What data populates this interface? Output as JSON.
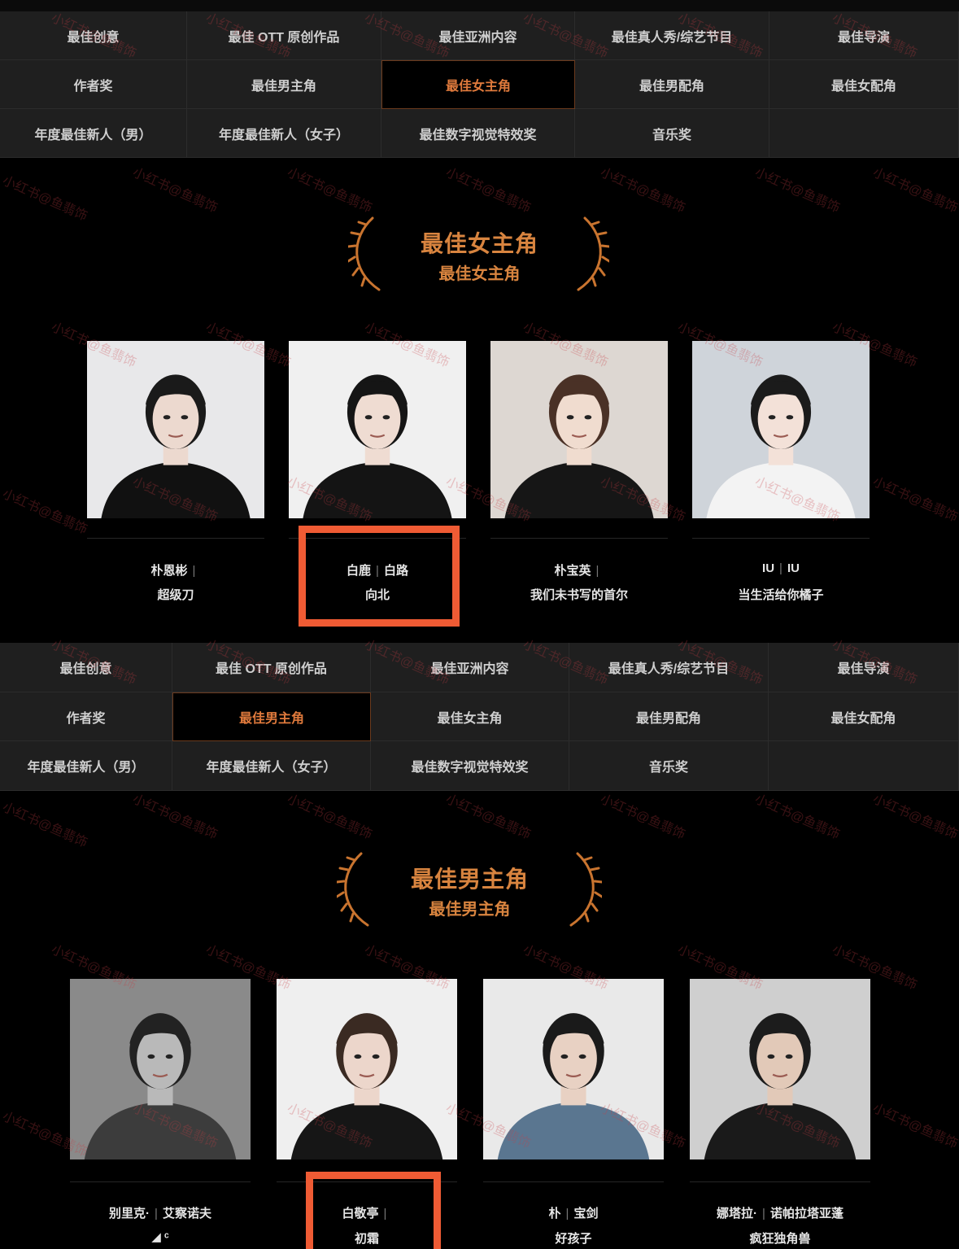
{
  "categories": [
    "最佳创意",
    "最佳 OTT 原创作品",
    "最佳亚洲内容",
    "最佳真人秀/综艺节目",
    "最佳导演",
    "作者奖",
    "最佳男主角",
    "最佳女主角",
    "最佳男配角",
    "最佳女配角",
    "年度最佳新人（男）",
    "年度最佳新人（女子）",
    "最佳数字视觉特效奖",
    "音乐奖",
    ""
  ],
  "section1": {
    "active_category": "最佳女主角",
    "award_title": "最佳女主角",
    "award_subtitle": "最佳女主角",
    "nominees": [
      {
        "name_a": "朴恩彬",
        "sep": "|",
        "name_b": "",
        "work": "超级刀",
        "highlight": false
      },
      {
        "name_a": "白鹿",
        "sep": "|",
        "name_b": "白路",
        "work": "向北",
        "highlight": true
      },
      {
        "name_a": "朴宝英",
        "sep": "|",
        "name_b": "",
        "work": "我们未书写的首尔",
        "highlight": false
      },
      {
        "name_a": "IU",
        "sep": "|",
        "name_b": "IU",
        "work": "当生活给你橘子",
        "highlight": false
      }
    ]
  },
  "section2": {
    "active_category": "最佳男主角",
    "award_title": "最佳男主角",
    "award_subtitle": "最佳男主角",
    "nominees": [
      {
        "name_a": "别里克·",
        "sep": "|",
        "name_b": "艾察诺夫",
        "work": "◢ ᶜ",
        "highlight": false
      },
      {
        "name_a": "白敬亭",
        "sep": "|",
        "name_b": "",
        "work": "初霜",
        "highlight": true
      },
      {
        "name_a": "朴",
        "sep": "|",
        "name_b": "宝剑",
        "work": "好孩子",
        "highlight": false
      },
      {
        "name_a": "娜塔拉·",
        "sep": "|",
        "name_b": "诺帕拉塔亚蓬",
        "work": "疯狂独角兽",
        "highlight": false
      }
    ]
  },
  "watermark_text": "小红书@鱼翡饰",
  "colors": {
    "accent": "#d8843f",
    "highlight": "#ef5b34",
    "cell": "#1f1f1f"
  }
}
